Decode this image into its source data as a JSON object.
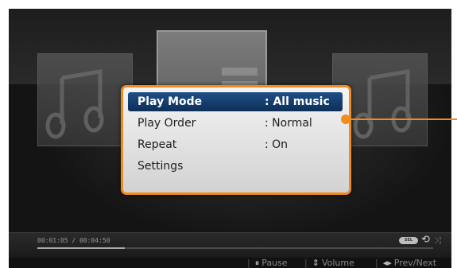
{
  "menu": {
    "items": [
      {
        "label": "Play Mode",
        "value": ": All music"
      },
      {
        "label": "Play Order",
        "value": ": Normal"
      },
      {
        "label": "Repeat",
        "value": ": On"
      },
      {
        "label": "Settings",
        "value": ""
      }
    ]
  },
  "playback": {
    "time": "00:01:05 / 00:04:50",
    "progress_fraction": 0.22,
    "select_badge": "SEL"
  },
  "hints": {
    "pause": "Pause",
    "volume": "Volume",
    "prev_next": "Prev/Next"
  },
  "colors": {
    "accent": "#f08c1c",
    "selection": "#1f4f86"
  }
}
